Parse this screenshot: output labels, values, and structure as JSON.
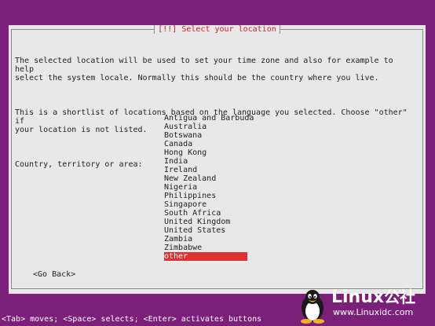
{
  "dialog": {
    "title": "[!!] Select your location",
    "paragraph1": "The selected location will be used to set your time zone and also for example to help\nselect the system locale. Normally this should be the country where you live.",
    "paragraph2": "This is a shortlist of locations based on the language you selected. Choose \"other\" if\nyour location is not listed.",
    "prompt": "Country, territory or area:",
    "options": [
      "Antigua and Barbuda",
      "Australia",
      "Botswana",
      "Canada",
      "Hong Kong",
      "India",
      "Ireland",
      "New Zealand",
      "Nigeria",
      "Philippines",
      "Singapore",
      "South Africa",
      "United Kingdom",
      "United States",
      "Zambia",
      "Zimbabwe",
      "other"
    ],
    "selected_option": "other",
    "go_back_label": "<Go Back>"
  },
  "status_bar": {
    "text": "<Tab> moves; <Space> selects; <Enter> activates buttons"
  },
  "watermark": {
    "brand": "Linux",
    "brand_suffix": "公社",
    "url": "www.Linuxidc.com",
    "icon": "tux-penguin-icon"
  },
  "colors": {
    "background": "#7b1f7a",
    "dialog": "#e8e8e8",
    "title_text": "#c0262b",
    "selection": "#e0302f"
  }
}
